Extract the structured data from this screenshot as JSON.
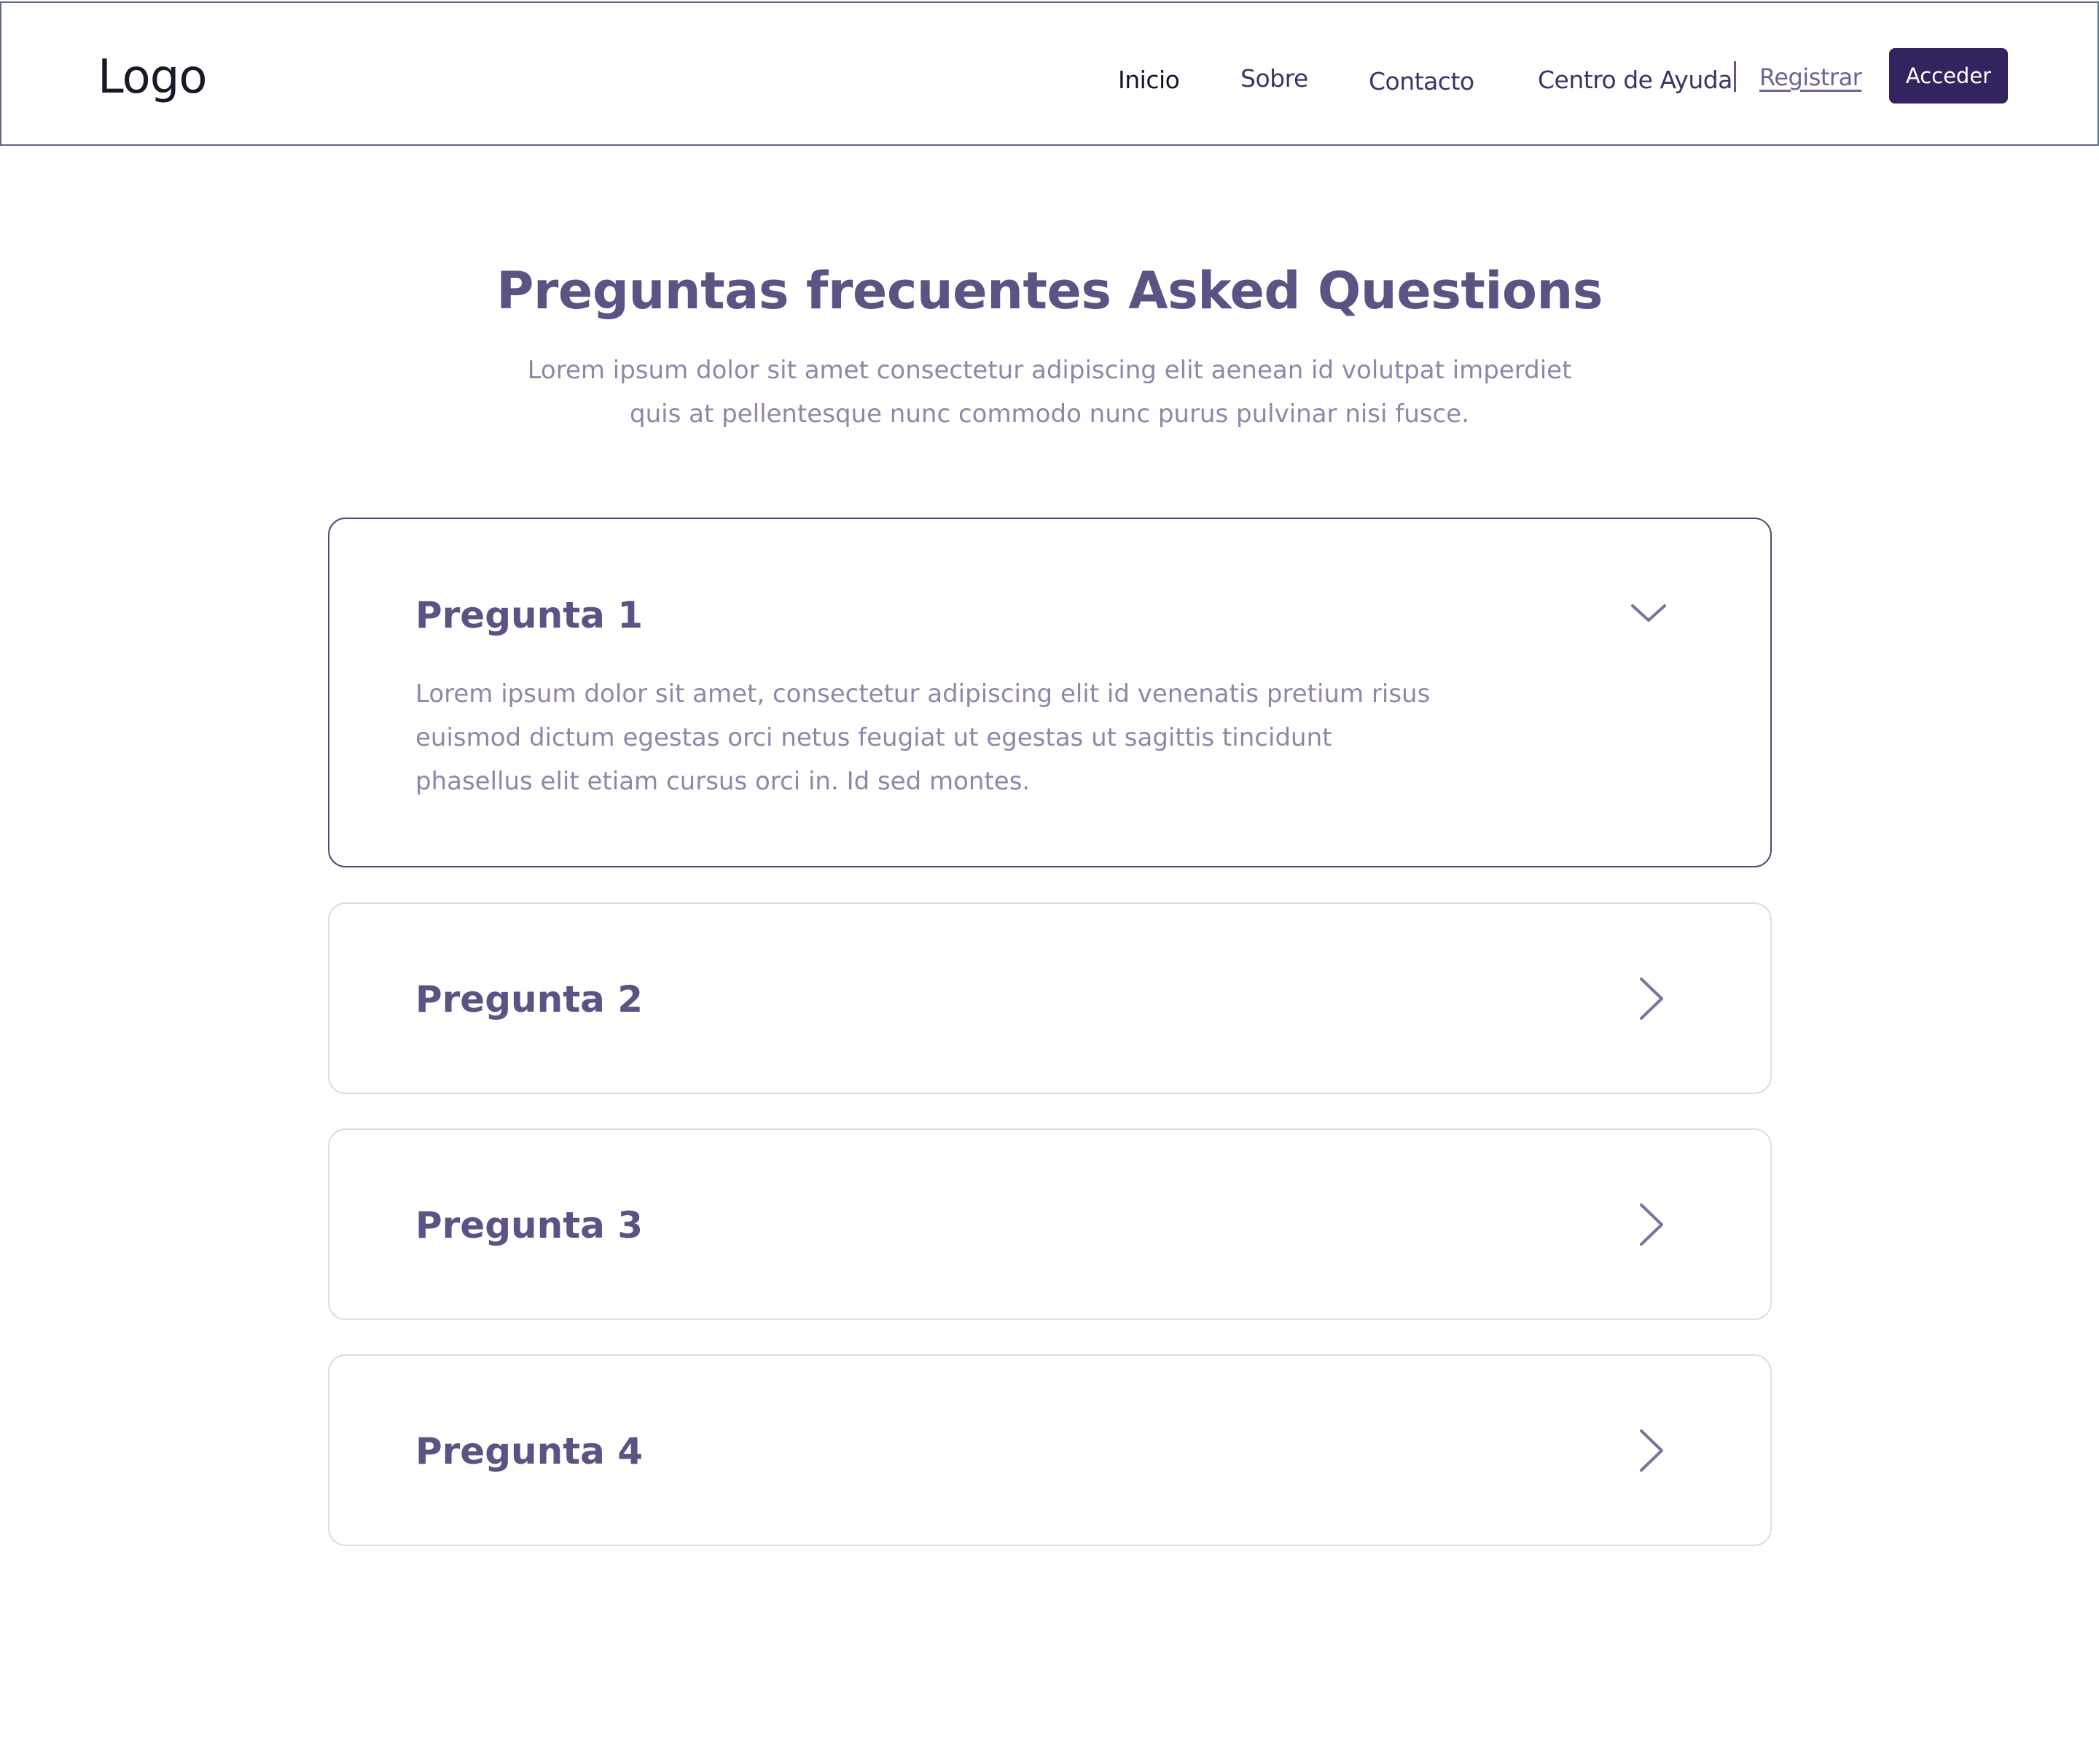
{
  "header": {
    "logo": "Logo",
    "nav": [
      {
        "label": "Inicio",
        "active": true
      },
      {
        "label": "Sobre",
        "active": false
      },
      {
        "label": "Contacto",
        "active": false
      },
      {
        "label": "Centro de Ayuda",
        "active": false
      }
    ],
    "register_label": "Registrar",
    "login_label": "Acceder"
  },
  "faq": {
    "title": "Preguntas frecuentes Asked Questions",
    "subtitle": "Lorem ipsum dolor sit amet consectetur adipiscing elit aenean id volutpat imperdiet quis at pellentesque nunc commodo nunc purus pulvinar nisi fusce.",
    "items": [
      {
        "question": "Pregunta 1",
        "answer": "Lorem ipsum dolor sit amet, consectetur adipiscing elit id venenatis pretium risus euismod dictum egestas orci netus feugiat ut egestas ut sagittis tincidunt phasellus elit etiam cursus orci in. Id sed montes.",
        "expanded": true,
        "icon": "chevron-down-icon"
      },
      {
        "question": "Pregunta 2",
        "expanded": false,
        "icon": "chevron-right-icon"
      },
      {
        "question": "Pregunta 3",
        "expanded": false,
        "icon": "chevron-right-icon"
      },
      {
        "question": "Pregunta 4",
        "expanded": false,
        "icon": "chevron-right-icon"
      }
    ]
  },
  "colors": {
    "accent": "#33245f",
    "heading": "#5b5383",
    "muted_text": "#8d88a8",
    "open_border": "#4f4a75",
    "closed_border": "#dddbe6"
  }
}
